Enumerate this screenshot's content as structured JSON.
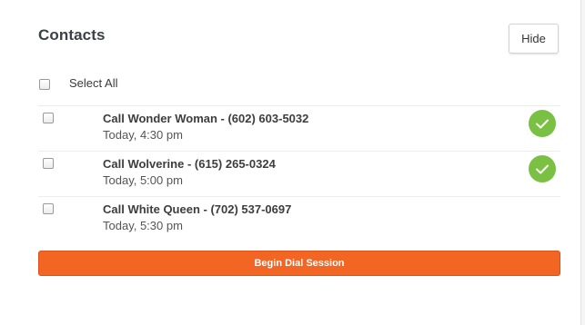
{
  "panel": {
    "title": "Contacts",
    "hide_label": "Hide",
    "select_all_label": "Select All",
    "dial_button_label": "Begin Dial Session"
  },
  "contacts": [
    {
      "title": "Call Wonder Woman - (602) 603-5032",
      "time": "Today, 4:30 pm",
      "completed": true
    },
    {
      "title": "Call Wolverine - (615) 265-0324",
      "time": "Today, 5:00 pm",
      "completed": true
    },
    {
      "title": "Call White Queen - (702) 537-0697",
      "time": "Today, 5:30 pm",
      "completed": false
    }
  ],
  "colors": {
    "accent": "#f26522",
    "success": "#7ac143"
  },
  "icons": {
    "completed": "check-icon"
  }
}
